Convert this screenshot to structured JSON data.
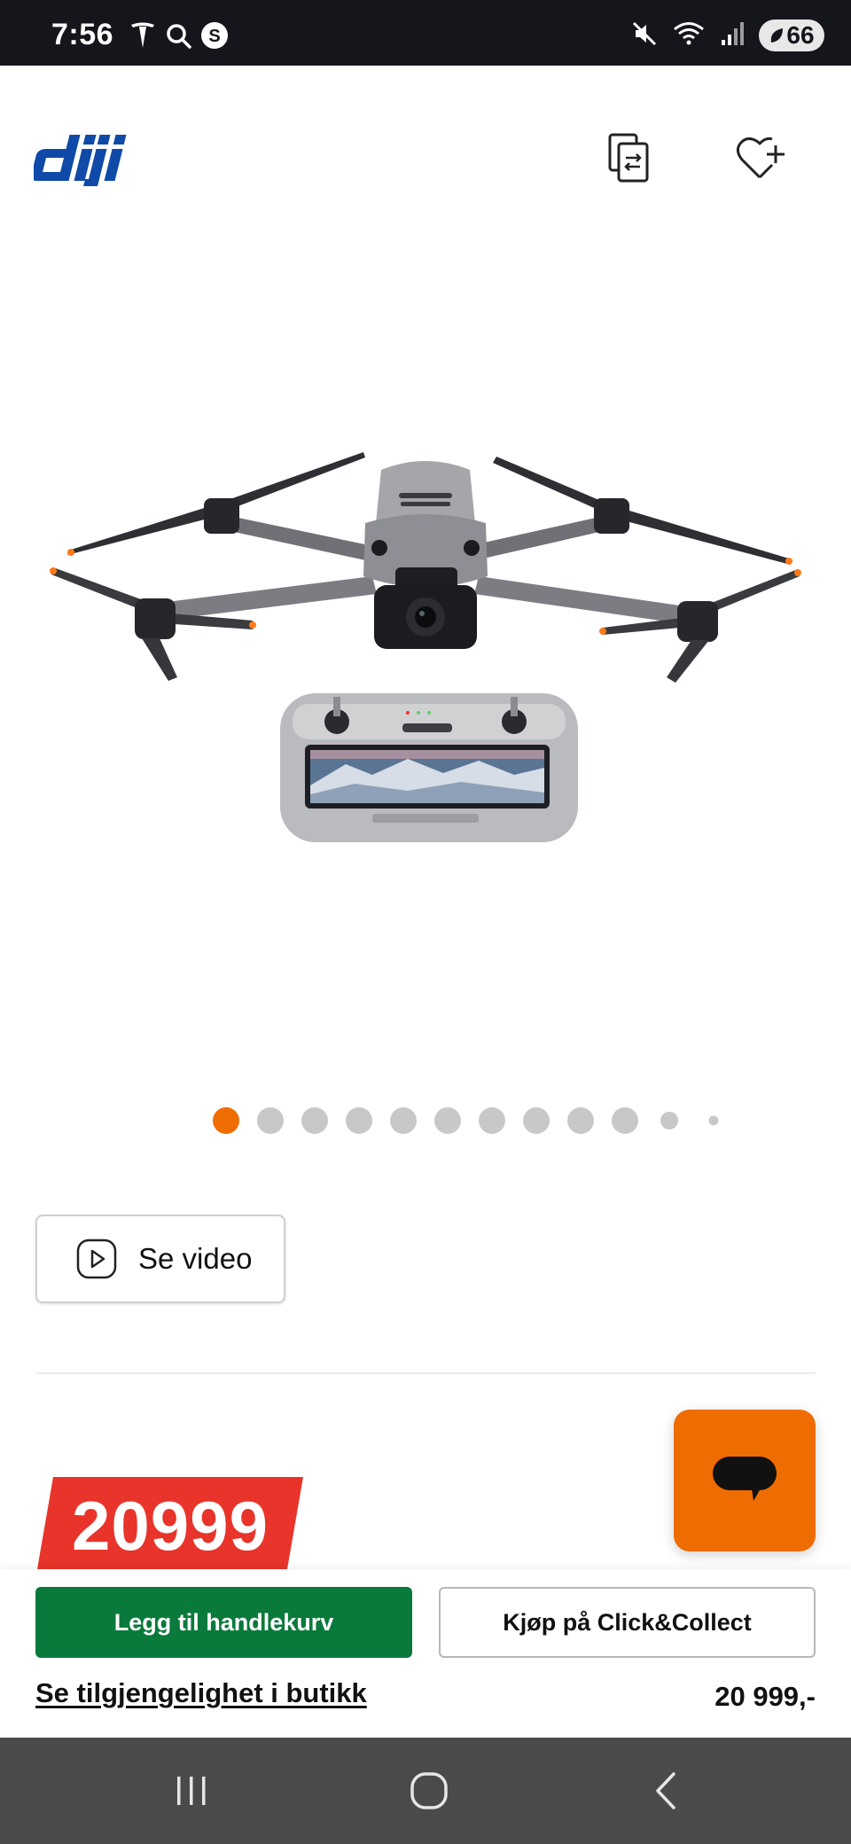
{
  "status_bar": {
    "time": "7:56",
    "left_icons": [
      "tesla-icon",
      "search-icon",
      "s-app-icon"
    ],
    "right_icons": [
      "mute-icon",
      "wifi-icon",
      "signal-icon"
    ],
    "battery": "66"
  },
  "header": {
    "logo_text": "dji",
    "compare_icon": "compare-icon",
    "wishlist_icon": "heart-plus-icon"
  },
  "gallery": {
    "dot_count": 12,
    "active_index": 0
  },
  "video_button": {
    "label": "Se video",
    "icon": "play-icon"
  },
  "price": {
    "value": "20999"
  },
  "chat": {
    "icon": "chat-icon"
  },
  "buy_bar": {
    "add_to_cart": "Legg til handlekurv",
    "click_collect": "Kjøp på Click&Collect",
    "availability_link": "Se tilgjengelighet i butikk",
    "price": "20 999,-"
  },
  "nav_bar": {
    "buttons": [
      "recent-apps-icon",
      "home-icon",
      "back-icon"
    ]
  },
  "colors": {
    "accent_orange": "#ef6c00",
    "price_red": "#e8342a",
    "cart_green": "#0a7a3c",
    "brand_blue": "#0f4aa8",
    "statusbar": "#14161c",
    "navbar": "#4a4a4a"
  }
}
